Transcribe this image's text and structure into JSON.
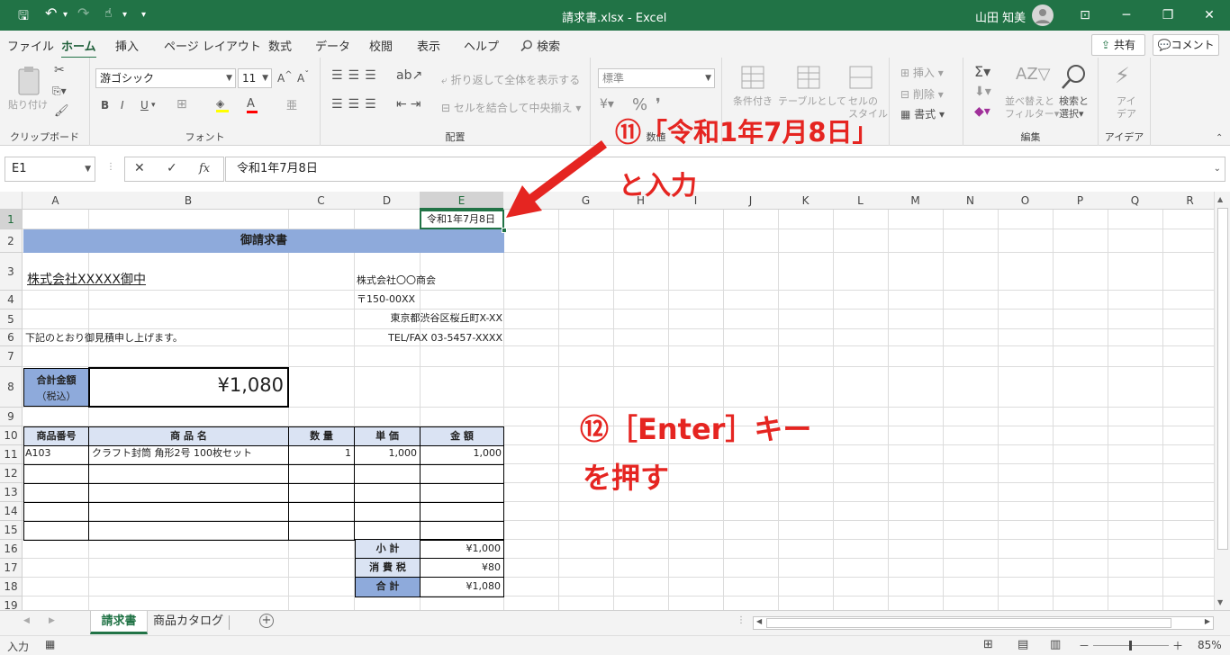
{
  "title": {
    "filename": "請求書.xlsx",
    "app": "Excel",
    "separator": " - ",
    "user": "山田 知美",
    "save_glyph": "🖫",
    "undo_glyph": "↶",
    "redo_glyph": "↷",
    "touch_glyph": "☝",
    "dropdown": "▾",
    "ribbon_display_glyph": "⊡",
    "minimize_glyph": "─",
    "restore_glyph": "❐",
    "close_glyph": "✕"
  },
  "menu": {
    "tabs": [
      "ファイル",
      "ホーム",
      "挿入",
      "ページ レイアウト",
      "数式",
      "データ",
      "校閲",
      "表示",
      "ヘルプ"
    ],
    "search_label": "検索",
    "share_label": "共有",
    "comment_label": "コメント"
  },
  "ribbon": {
    "clipboard": {
      "paste": "貼り付け",
      "group": "クリップボード"
    },
    "font": {
      "name": "游ゴシック",
      "size": "11",
      "bold": "B",
      "italic": "I",
      "underline": "U",
      "group": "フォント"
    },
    "align": {
      "wrap": "折り返して全体を表示する",
      "merge": "セルを結合して中央揃え",
      "group": "配置"
    },
    "number": {
      "format": "標準",
      "percent": "%",
      "comma": "❜",
      "group": "数値"
    },
    "styles": {
      "cond": "条件付き",
      "table": "テーブルとして",
      "cell": "セルの",
      "cell2": "スタイル"
    },
    "cells": {
      "insert": "挿入",
      "delete": "削除",
      "format": "書式"
    },
    "edit": {
      "sort": "並べ替えと",
      "sort2": "フィルター",
      "find": "検索と",
      "find2": "選択",
      "group": "編集"
    },
    "idea": {
      "label": "アイ",
      "label2": "デア",
      "group": "アイデア"
    }
  },
  "formula_bar": {
    "name_box": "E1",
    "cancel": "✕",
    "enter": "✓",
    "fx": "fx",
    "content": "令和1年7月8日"
  },
  "columns": [
    "A",
    "B",
    "C",
    "D",
    "E",
    "F",
    "G",
    "H",
    "I",
    "J",
    "K",
    "L",
    "M",
    "N",
    "O",
    "P",
    "Q",
    "R"
  ],
  "rows": [
    "1",
    "2",
    "3",
    "4",
    "5",
    "6",
    "7",
    "8",
    "9",
    "10",
    "11",
    "12",
    "13",
    "14",
    "15",
    "16",
    "17",
    "18",
    "19"
  ],
  "sheet": {
    "e1": "令和1年7月8日",
    "title": "御請求書",
    "customer": "株式会社XXXXX御中",
    "company": "株式会社〇〇商会",
    "zip": "〒150-00XX",
    "address": "東京都渋谷区桜丘町X-XX",
    "tel": "TEL/FAX 03-5457-XXXX",
    "note": "下記のとおり御見積申し上げます。",
    "total_label": "合計金額",
    "total_sub": "（税込）",
    "total_value": "¥1,080",
    "headers": [
      "商品番号",
      "商 品 名",
      "数 量",
      "単 価",
      "金 額"
    ],
    "item": {
      "code": "A103",
      "name": "クラフト封筒 角形2号 100枚セット",
      "qty": "1",
      "price": "1,000",
      "amount": "1,000"
    },
    "subtotal_label": "小 計",
    "subtotal": "¥1,000",
    "tax_label": "消 費 税",
    "tax": "¥80",
    "grand_label": "合 計",
    "grand": "¥1,080"
  },
  "sheet_tabs": [
    "請求書",
    "商品カタログ"
  ],
  "status": {
    "mode": "入力",
    "zoom": "85%",
    "minus": "－",
    "plus": "＋"
  },
  "annotations": {
    "step11": "⑪「令和1年7月8日」",
    "step11b": "と入力",
    "step12": "⑫［Enter］キー",
    "step12b": "を押す",
    "color": "#e52521"
  }
}
